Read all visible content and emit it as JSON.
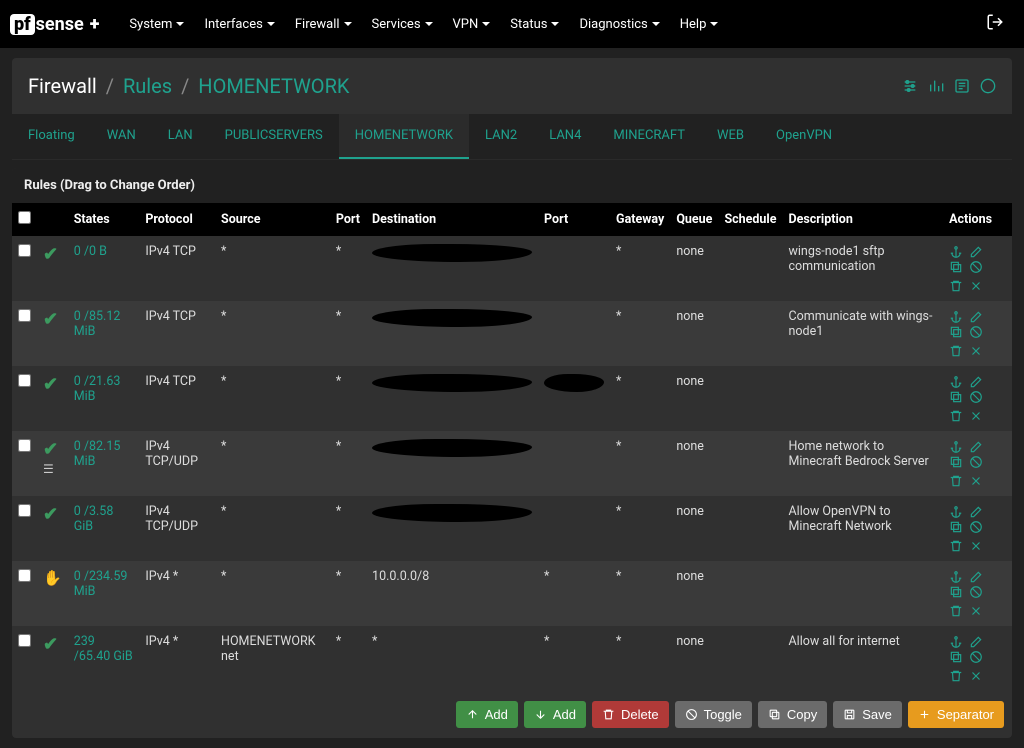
{
  "brand": {
    "box": "pf",
    "text": "sense",
    "plus": "+"
  },
  "nav": {
    "items": [
      "System",
      "Interfaces",
      "Firewall",
      "Services",
      "VPN",
      "Status",
      "Diagnostics",
      "Help"
    ]
  },
  "breadcrumb": {
    "root": "Firewall",
    "mid": "Rules",
    "leaf": "HOMENETWORK"
  },
  "tabs": [
    "Floating",
    "WAN",
    "LAN",
    "PUBLICSERVERS",
    "HOMENETWORK",
    "LAN2",
    "LAN4",
    "MINECRAFT",
    "WEB",
    "OpenVPN"
  ],
  "active_tab": "HOMENETWORK",
  "panel_title": "Rules (Drag to Change Order)",
  "columns": [
    "",
    "",
    "States",
    "Protocol",
    "Source",
    "Port",
    "Destination",
    "Port",
    "Gateway",
    "Queue",
    "Schedule",
    "Description",
    "Actions"
  ],
  "rows": [
    {
      "icon": "check",
      "states": "0 /0 B",
      "protocol": "IPv4 TCP",
      "source": "*",
      "port": "*",
      "dest": "",
      "dport": "",
      "gateway": "*",
      "queue": "none",
      "schedule": "",
      "description": "wings-node1 sftp communication"
    },
    {
      "icon": "check",
      "states": "0 /85.12 MiB",
      "protocol": "IPv4 TCP",
      "source": "*",
      "port": "*",
      "dest": "",
      "dport": "",
      "gateway": "*",
      "queue": "none",
      "schedule": "",
      "description": "Communicate with wings-node1"
    },
    {
      "icon": "check",
      "states": "0 /21.63 MiB",
      "protocol": "IPv4 TCP",
      "source": "*",
      "port": "*",
      "dest": "",
      "dport": "",
      "gateway": "*",
      "queue": "none",
      "schedule": "",
      "description": ""
    },
    {
      "icon": "check",
      "sub_icon": "list",
      "states": "0 /82.15 MiB",
      "protocol": "IPv4 TCP/UDP",
      "source": "*",
      "port": "*",
      "dest": "",
      "dport": "",
      "gateway": "*",
      "queue": "none",
      "schedule": "",
      "description": "Home network to Minecraft Bedrock Server"
    },
    {
      "icon": "check",
      "states": "0 /3.58 GiB",
      "protocol": "IPv4 TCP/UDP",
      "source": "*",
      "port": "*",
      "dest": "",
      "dport": "",
      "gateway": "*",
      "queue": "none",
      "schedule": "",
      "description": "Allow OpenVPN to Minecraft Network"
    },
    {
      "icon": "hand",
      "states": "0 /234.59 MiB",
      "protocol": "IPv4 *",
      "source": "*",
      "port": "*",
      "dest": "10.0.0.0/8",
      "dport": "*",
      "gateway": "*",
      "queue": "none",
      "schedule": "",
      "description": ""
    },
    {
      "icon": "check",
      "states": "239 /65.40 GiB",
      "protocol": "IPv4 *",
      "source": "HOMENETWORK net",
      "port": "*",
      "dest": "*",
      "dport": "*",
      "gateway": "*",
      "queue": "none",
      "schedule": "",
      "description": "Allow all for internet"
    }
  ],
  "footer": {
    "add_up": "Add",
    "add_down": "Add",
    "delete": "Delete",
    "toggle": "Toggle",
    "copy": "Copy",
    "save": "Save",
    "separator": "Separator"
  }
}
